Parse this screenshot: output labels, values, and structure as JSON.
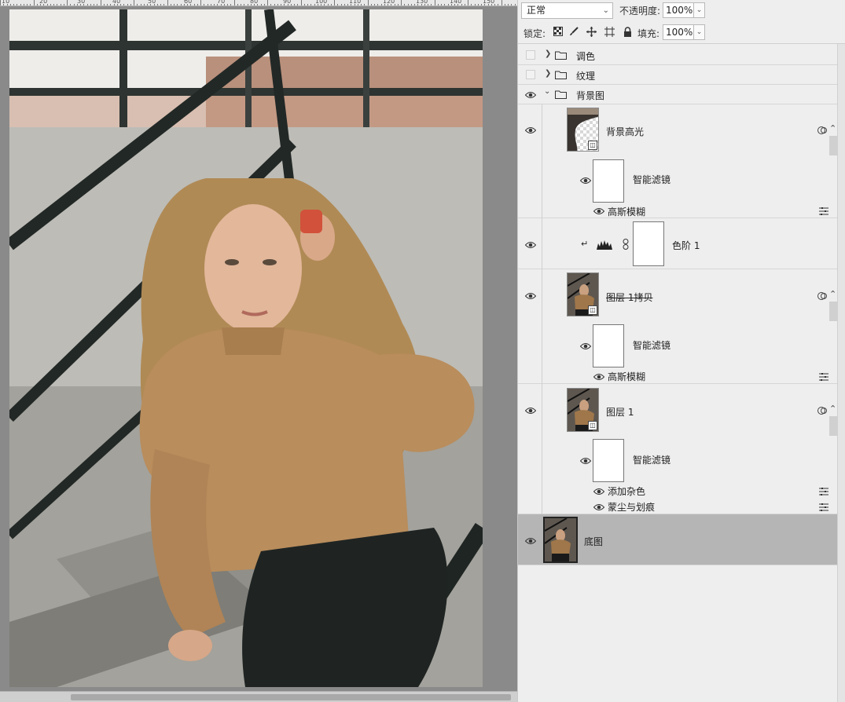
{
  "ruler": {
    "numbers": [
      "10",
      "20",
      "30",
      "40",
      "50",
      "60",
      "70",
      "80",
      "90",
      "100",
      "110",
      "120",
      "130",
      "140",
      "150"
    ]
  },
  "layers_panel": {
    "blend_mode": "正常",
    "opacity_label": "不透明度:",
    "opacity_value": "100%",
    "lock_label": "锁定:",
    "fill_label": "填充:",
    "fill_value": "100%",
    "layers": [
      {
        "name": "调色",
        "kind": "group",
        "visible": false,
        "expanded": false
      },
      {
        "name": "纹理",
        "kind": "group",
        "visible": false,
        "expanded": false
      },
      {
        "name": "背景图",
        "kind": "group",
        "visible": true,
        "expanded": true
      },
      {
        "name": "背景高光",
        "kind": "smart-object",
        "visible": true
      },
      {
        "name": "智能滤镜",
        "kind": "filter-mask",
        "visible": true
      },
      {
        "name": "高斯模糊",
        "kind": "filter",
        "visible": true
      },
      {
        "name": "色阶 1",
        "kind": "adjustment",
        "visible": true
      },
      {
        "name": "图层 1拷贝",
        "kind": "smart-object",
        "visible": true
      },
      {
        "name": "智能滤镜",
        "kind": "filter-mask",
        "visible": true
      },
      {
        "name": "高斯模糊",
        "kind": "filter",
        "visible": true
      },
      {
        "name": "图层 1",
        "kind": "smart-object",
        "visible": true
      },
      {
        "name": "智能滤镜",
        "kind": "filter-mask",
        "visible": true
      },
      {
        "name": "添加杂色",
        "kind": "filter",
        "visible": true
      },
      {
        "name": "蒙尘与划痕",
        "kind": "filter",
        "visible": true
      },
      {
        "name": "底图",
        "kind": "pixel",
        "visible": true,
        "selected": true
      }
    ]
  },
  "colors": {
    "panel_bg": "#eeeeee",
    "selected_row": "#b5b5b5",
    "canvas_bg": "#8a8a8a"
  },
  "icons": [
    "eye-icon",
    "folder-icon",
    "chevron-right-icon",
    "chevron-down-icon",
    "lock-transparent-icon",
    "lock-brush-icon",
    "lock-move-icon",
    "lock-artboard-icon",
    "lock-all-icon",
    "smart-object-badge-icon",
    "levels-icon",
    "link-icon",
    "clip-arrow-icon",
    "filter-options-icon",
    "scroll-up-icon"
  ]
}
